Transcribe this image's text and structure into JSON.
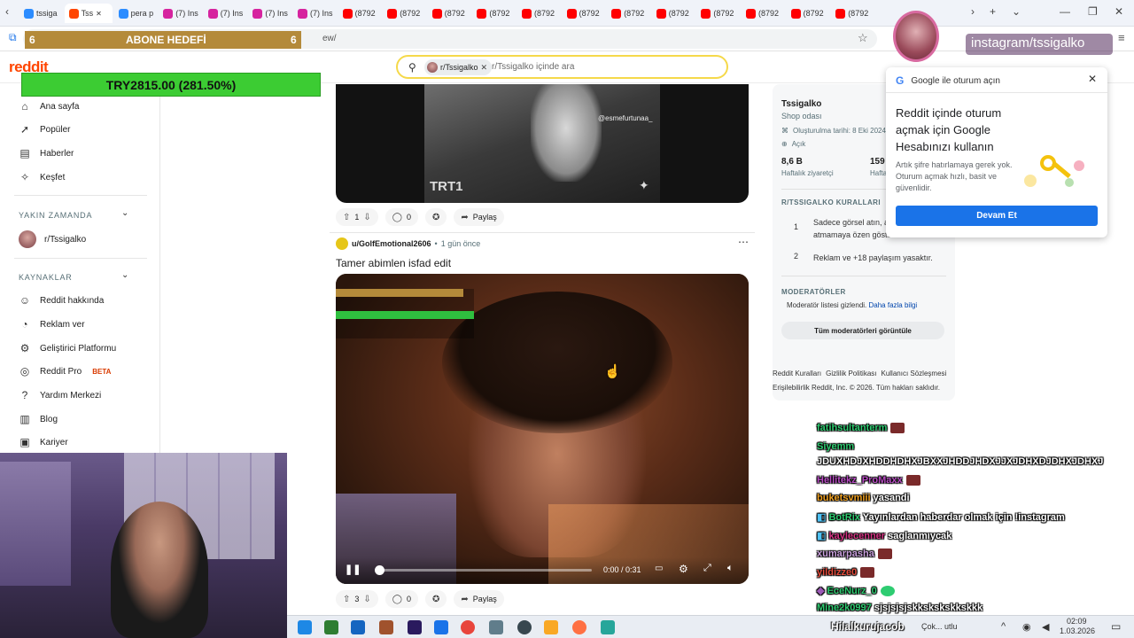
{
  "browser": {
    "tabs": [
      {
        "label": "tssiga",
        "color": "#2c8cff"
      },
      {
        "label": "Tss",
        "color": "#ff4500",
        "active": true
      },
      {
        "label": "pera p",
        "color": "#2c8cff"
      },
      {
        "label": "(7) Ins",
        "color": "#d6249f"
      },
      {
        "label": "(7) Ins",
        "color": "#d6249f"
      },
      {
        "label": "(7) Ins",
        "color": "#d6249f"
      },
      {
        "label": "(7) Ins",
        "color": "#d6249f"
      },
      {
        "label": "(8792",
        "color": "#ff0000"
      },
      {
        "label": "(8792",
        "color": "#ff0000"
      },
      {
        "label": "(8792",
        "color": "#ff0000"
      },
      {
        "label": "(8792",
        "color": "#ff0000"
      },
      {
        "label": "(8792",
        "color": "#ff0000"
      },
      {
        "label": "(8792",
        "color": "#ff0000"
      },
      {
        "label": "(8792",
        "color": "#ff0000"
      },
      {
        "label": "(8792",
        "color": "#ff0000"
      },
      {
        "label": "(8792",
        "color": "#ff0000"
      },
      {
        "label": "(8792",
        "color": "#ff0000"
      },
      {
        "label": "(8792",
        "color": "#ff0000"
      },
      {
        "label": "(8792",
        "color": "#ff0000"
      }
    ],
    "url_fragment": "ew/"
  },
  "stream_overlay": {
    "goal_label": "ABONE HEDEFİ",
    "goal_left": "6",
    "goal_right": "6",
    "donation": "TRY2815.00 (281.50%)",
    "instagram": "instagram/tssigalko"
  },
  "header": {
    "logo": "reddit",
    "search_chip": "r/Tssigalko",
    "search_placeholder": "r/Tssigalko içinde ara"
  },
  "sidebar": {
    "items_top": [
      {
        "label": "Ana sayfa",
        "icon": "home-icon"
      },
      {
        "label": "Popüler",
        "icon": "popular-icon"
      },
      {
        "label": "Haberler",
        "icon": "news-icon"
      },
      {
        "label": "Keşfet",
        "icon": "explore-icon"
      }
    ],
    "recent_header": "YAKIN ZAMANDA",
    "recent_items": [
      {
        "label": "r/Tssigalko"
      }
    ],
    "resources_header": "KAYNAKLAR",
    "resources_items": [
      {
        "label": "Reddit hakkında"
      },
      {
        "label": "Reklam ver"
      },
      {
        "label": "Geliştirici Platformu"
      },
      {
        "label": "Reddit Pro",
        "badge": "BETA"
      },
      {
        "label": "Yardım Merkezi"
      },
      {
        "label": "Blog"
      },
      {
        "label": "Kariyer"
      }
    ]
  },
  "feed": {
    "post1": {
      "watermark": "TRT1",
      "tiktok": "@esmefurtunaa_",
      "votes": "1",
      "comments": "0",
      "share": "Paylaş"
    },
    "post2": {
      "author": "u/GolfEmotional2606",
      "time": "1 gün önce",
      "title": "Tamer abimlen isfad edit",
      "video_time": "0:00 / 0:31",
      "votes": "3",
      "comments": "0",
      "share": "Paylaş"
    }
  },
  "community": {
    "name": "Tssigalko",
    "subtitle": "Shop odası",
    "created": "Oluşturulma tarihi: 8 Eki 2024",
    "visibility": "Açık",
    "weekly_visitors_value": "8,6 B",
    "weekly_visitors_label": "Haftalık ziyaretçi",
    "weekly_contrib_value": "159",
    "weekly_contrib_label": "Hafta",
    "rules_header": "R/TSSIGALKO KURALLARI",
    "rules": [
      {
        "num": "1",
        "text": "Sadece görsel atın, a... atmamaya özen göste..."
      },
      {
        "num": "2",
        "text": "Reklam ve +18 paylaşım yasaktır."
      }
    ],
    "mods_header": "MODERATÖRLER",
    "mods_text": "Moderatör listesi gizlendi.",
    "mods_link": "Daha fazla bilgi",
    "mods_button": "Tüm moderatörleri görüntüle",
    "footer_links": [
      "Reddit Kuralları",
      "Gizlilik Politikası",
      "Kullanıcı Sözleşmesi"
    ],
    "footer_line2": "Erişilebilirlik  Reddit, Inc. © 2026. Tüm hakları saklıdır."
  },
  "google_popup": {
    "header": "Google ile oturum açın",
    "title": "Reddit içinde oturum açmak için Google Hesabınızı kullanın",
    "body": "Artık şifre hatırlamaya gerek yok. Oturum açmak hızlı, basit ve güvenlidir.",
    "button": "Devam Et"
  },
  "chat": [
    {
      "user": "fatihsultanterm",
      "msg": "",
      "color": "#2ecc71"
    },
    {
      "user": "Siyemm",
      "msg": "JDUXHDJXHDDHDHXJBXXJHDDJHDXJJXJDHXDJDHXJDHXJ",
      "color": "#2ecc71"
    },
    {
      "user": "Hellitekz_ProMaxx",
      "msg": "",
      "color": "#b84cc4"
    },
    {
      "user": "buketsvmiii",
      "msg": "yasandi",
      "color": "#f0a020"
    },
    {
      "user": "BotRix",
      "msg": "Yayınlardan haberdar olmak için !instagram",
      "color": "#2ecc71"
    },
    {
      "user": "kaylecenner",
      "msg": "saglanmıycak",
      "color": "#d63384"
    },
    {
      "user": "xumarpasha",
      "msg": "",
      "color": "#c9a0dc"
    },
    {
      "user": "yildizze0",
      "msg": "",
      "color": "#e74c3c"
    },
    {
      "user": "EceNurz_0",
      "msg": "",
      "color": "#2ecc71"
    },
    {
      "user": "Mine2k0997",
      "msg": "sjsjsjsjskkskskskkskkk",
      "color": "#2ecc71"
    }
  ],
  "taskbar": {
    "streamer": "Hilalkurujacob",
    "weather": "Çok... utlu",
    "time": "02:09",
    "date": "1.03.2026"
  }
}
